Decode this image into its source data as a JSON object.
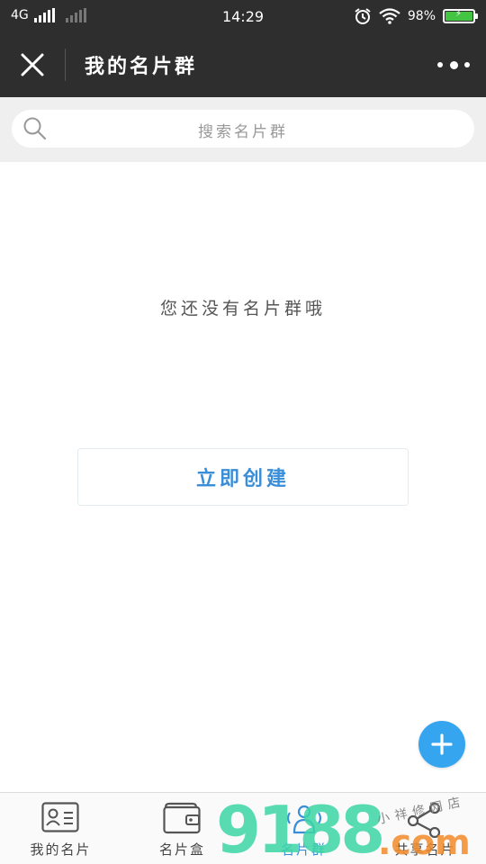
{
  "status_bar": {
    "network": "4G",
    "time": "14:29",
    "battery": "98%"
  },
  "header": {
    "title": "我的名片群"
  },
  "search": {
    "placeholder": "搜索名片群"
  },
  "main": {
    "empty_message": "您还没有名片群哦",
    "create_label": "立即创建"
  },
  "tabs": [
    {
      "label": "我的名片",
      "icon": "id-card-icon"
    },
    {
      "label": "名片盒",
      "icon": "wallet-icon"
    },
    {
      "label": "名片群",
      "icon": "group-icon"
    },
    {
      "label": "共享名片",
      "icon": "share-icon"
    }
  ],
  "watermark": {
    "number": "9188",
    "domain": ".com",
    "text": "小祥修网店"
  },
  "colors": {
    "dark_bar": "#2e2e2e",
    "accent": "#3a8ed8",
    "fab": "#36a5f0",
    "battery": "#43c543"
  }
}
